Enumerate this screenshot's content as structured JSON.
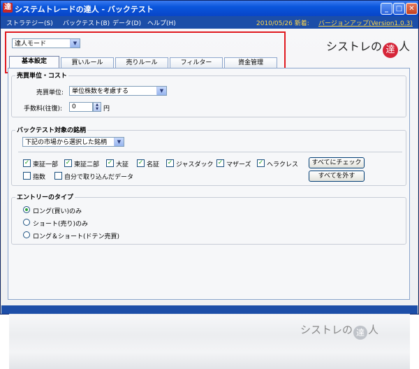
{
  "window": {
    "title": "システムトレードの達人 - バックテスト",
    "icon_glyph": "達",
    "minimize_glyph": "_",
    "maximize_glyph": "□",
    "close_glyph": "✕"
  },
  "menu": {
    "items": [
      "ストラテジー(S)",
      "バックテスト(B)",
      "データ(D)",
      "ヘルプ(H)"
    ],
    "notice_date": "2010/05/26 新着:",
    "notice_link": "バージョンアップ(Version1.0.3)"
  },
  "mode_select": {
    "value": "達人モード"
  },
  "logo": {
    "pre": "シストレの",
    "seal": "達",
    "post": "人"
  },
  "tabs": [
    "基本設定",
    "買いルール",
    "売りルール",
    "フィルター",
    "資金管理"
  ],
  "active_tab_index": 0,
  "cost_group": {
    "title": "売買単位・コスト",
    "unit_label": "売買単位:",
    "unit_value": "単位株数を考慮する",
    "fee_label": "手数料(往復):",
    "fee_value": "0",
    "fee_unit": "円"
  },
  "stocks_group": {
    "title": "バックテスト対象の銘柄",
    "select_value": "下記の市場から選択した銘柄",
    "markets": [
      {
        "label": "東証一部",
        "checked": true
      },
      {
        "label": "東証二部",
        "checked": true
      },
      {
        "label": "大証",
        "checked": true
      },
      {
        "label": "名証",
        "checked": true
      },
      {
        "label": "ジャスダック",
        "checked": true
      },
      {
        "label": "マザーズ",
        "checked": true
      },
      {
        "label": "ヘラクレス",
        "checked": true
      }
    ],
    "extra": [
      {
        "label": "指数",
        "checked": false
      },
      {
        "label": "自分で取り込んだデータ",
        "checked": false
      }
    ],
    "check_all_label": "すべてにチェック",
    "uncheck_all_label": "すべてを外す"
  },
  "entry_group": {
    "title": "エントリーのタイプ",
    "options": [
      {
        "label": "ロング(買い)のみ",
        "selected": true
      },
      {
        "label": "ショート(売り)のみ",
        "selected": false
      },
      {
        "label": "ロング＆ショート(ドテン売買)",
        "selected": false
      }
    ]
  },
  "watermark_logo": {
    "pre": "シストレの",
    "seal": "達",
    "post": "人"
  },
  "colors": {
    "titlebar": "#0a56dc",
    "menubar": "#1c4ea8",
    "highlight_border": "#e0191f",
    "notice": "#ffd84a",
    "check": "#21a121",
    "seal": "#d6263a"
  },
  "icons": {
    "app": "app-icon",
    "dropdown": "chevron-down-icon",
    "spin": "spinner-icon"
  }
}
